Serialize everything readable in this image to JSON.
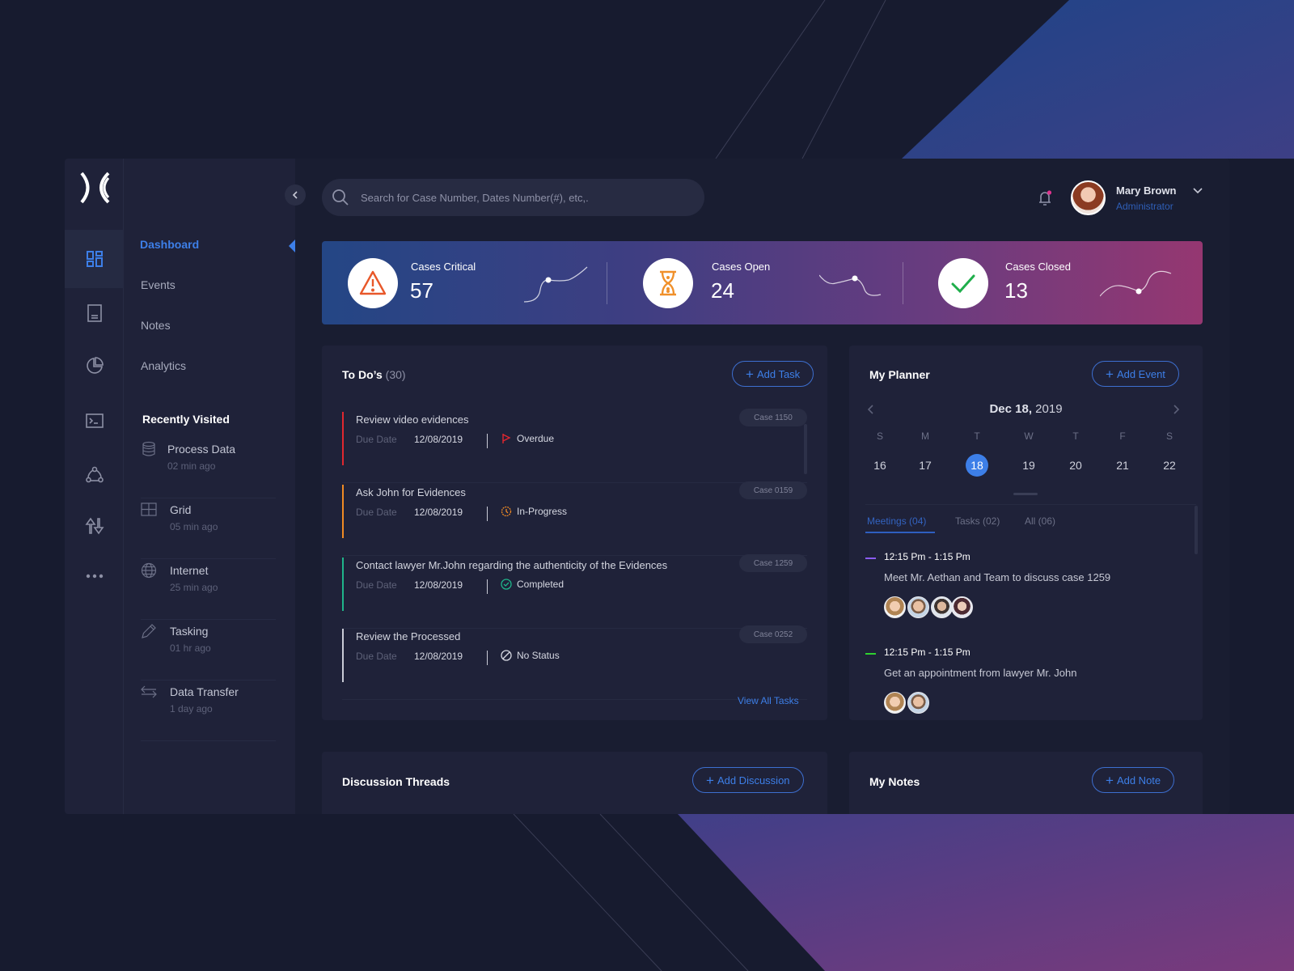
{
  "search": {
    "placeholder": "Search for Case Number, Dates Number(#), etc,."
  },
  "user": {
    "name": "Mary Brown",
    "role": "Administrator",
    "has_notification": true
  },
  "rail": {
    "icons": [
      "dashboard-icon",
      "document-icon",
      "pie-chart-icon",
      "terminal-icon",
      "network-icon",
      "transfer-icon",
      "more-icon"
    ],
    "active_index": 0
  },
  "nav": {
    "items": [
      {
        "label": "Dashboard",
        "active": true
      },
      {
        "label": "Events"
      },
      {
        "label": "Notes"
      },
      {
        "label": "Analytics"
      }
    ],
    "recent_title": "Recently Visited",
    "recent": [
      {
        "name": "Process Data",
        "time": "02 min ago",
        "icon": "database-icon"
      },
      {
        "name": "Grid",
        "time": "05 min ago",
        "icon": "grid-icon"
      },
      {
        "name": "Internet",
        "time": "25 min ago",
        "icon": "globe-icon"
      },
      {
        "name": "Tasking",
        "time": "01 hr ago",
        "icon": "pencil-icon"
      },
      {
        "name": "Data Transfer",
        "time": "1 day ago",
        "icon": "transfer-arrows-icon"
      }
    ]
  },
  "stats": [
    {
      "label": "Cases Critical",
      "value": "57",
      "icon": "warning-icon",
      "icon_color": "#e8582a"
    },
    {
      "label": "Cases Open",
      "value": "24",
      "icon": "hourglass-icon",
      "icon_color": "#f0902a"
    },
    {
      "label": "Cases Closed",
      "value": "13",
      "icon": "check-icon",
      "icon_color": "#1fae4b"
    }
  ],
  "todos": {
    "title": "To Do’s",
    "count": "(30)",
    "add_label": "Add Task",
    "due_label": "Due Date",
    "view_all": "View All Tasks",
    "items": [
      {
        "title": "Review video evidences",
        "due": "12/08/2019",
        "status": "Overdue",
        "status_icon": "flag-icon",
        "color": "#e0272f",
        "case": "Case 1150"
      },
      {
        "title": "Ask John for Evidences",
        "due": "12/08/2019",
        "status": "In-Progress",
        "status_icon": "clock-icon",
        "color": "#f08a24",
        "case": "Case 0159"
      },
      {
        "title": "Contact lawyer Mr.John regarding the authenticity of the Evidences",
        "due": "12/08/2019",
        "status": "Completed",
        "status_icon": "check-circle-icon",
        "color": "#1fb58a",
        "case": "Case 1259"
      },
      {
        "title": "Review the Processed",
        "due": "12/08/2019",
        "status": "No Status",
        "status_icon": "no-status-icon",
        "color": "#c9cbd6",
        "case": "Case 0252"
      }
    ]
  },
  "planner": {
    "title": "My Planner",
    "add_label": "Add Event",
    "month_day": "Dec 18,",
    "year": "2019",
    "weekdays": [
      "S",
      "M",
      "T",
      "W",
      "T",
      "F",
      "S"
    ],
    "days": [
      "16",
      "17",
      "18",
      "19",
      "20",
      "21",
      "22"
    ],
    "selected_day": "18",
    "tabs": [
      {
        "label": "Meetings (04)",
        "active": true
      },
      {
        "label": "Tasks (02)"
      },
      {
        "label": "All (06)"
      }
    ],
    "meetings": [
      {
        "time": "12:15 Pm - 1:15 Pm",
        "desc": "Meet Mr. Aethan and Team to discuss case 1259",
        "color": "#8b5cf6",
        "attendees": 4
      },
      {
        "time": "12:15 Pm - 1:15 Pm",
        "desc": "Get an appointment from lawyer Mr. John",
        "color": "#2fd12f",
        "attendees": 2
      }
    ]
  },
  "discussions": {
    "title": "Discussion Threads",
    "add_label": "Add Discussion"
  },
  "notes": {
    "title": "My Notes",
    "add_label": "Add Note"
  },
  "colors": {
    "accent": "#3d7fe8",
    "background": "#171b2f",
    "panel": "#1f2239"
  }
}
